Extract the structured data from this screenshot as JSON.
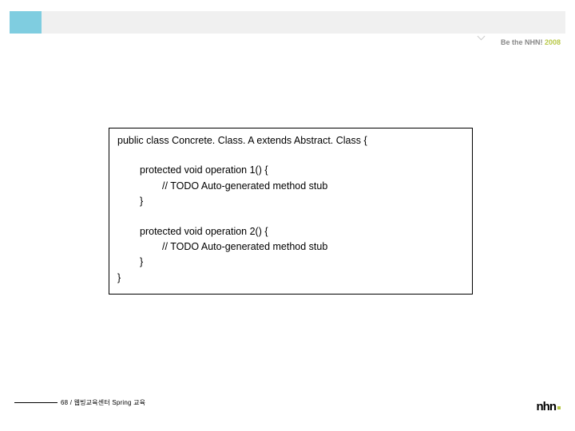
{
  "header": {
    "tagline_prefix": "Be the NHN! ",
    "tagline_year": "2008"
  },
  "code": {
    "line1": "public class Concrete. Class. A extends Abstract. Class {",
    "line2": "protected void operation 1() {",
    "line3": "// TODO Auto-generated method stub",
    "line4": "}",
    "line5": "protected void operation 2() {",
    "line6": "// TODO Auto-generated method stub",
    "line7": "}",
    "line8": "}"
  },
  "footer": {
    "text": "68 / 웹빙교육센터 Spring 교육",
    "logo": "nhn"
  }
}
